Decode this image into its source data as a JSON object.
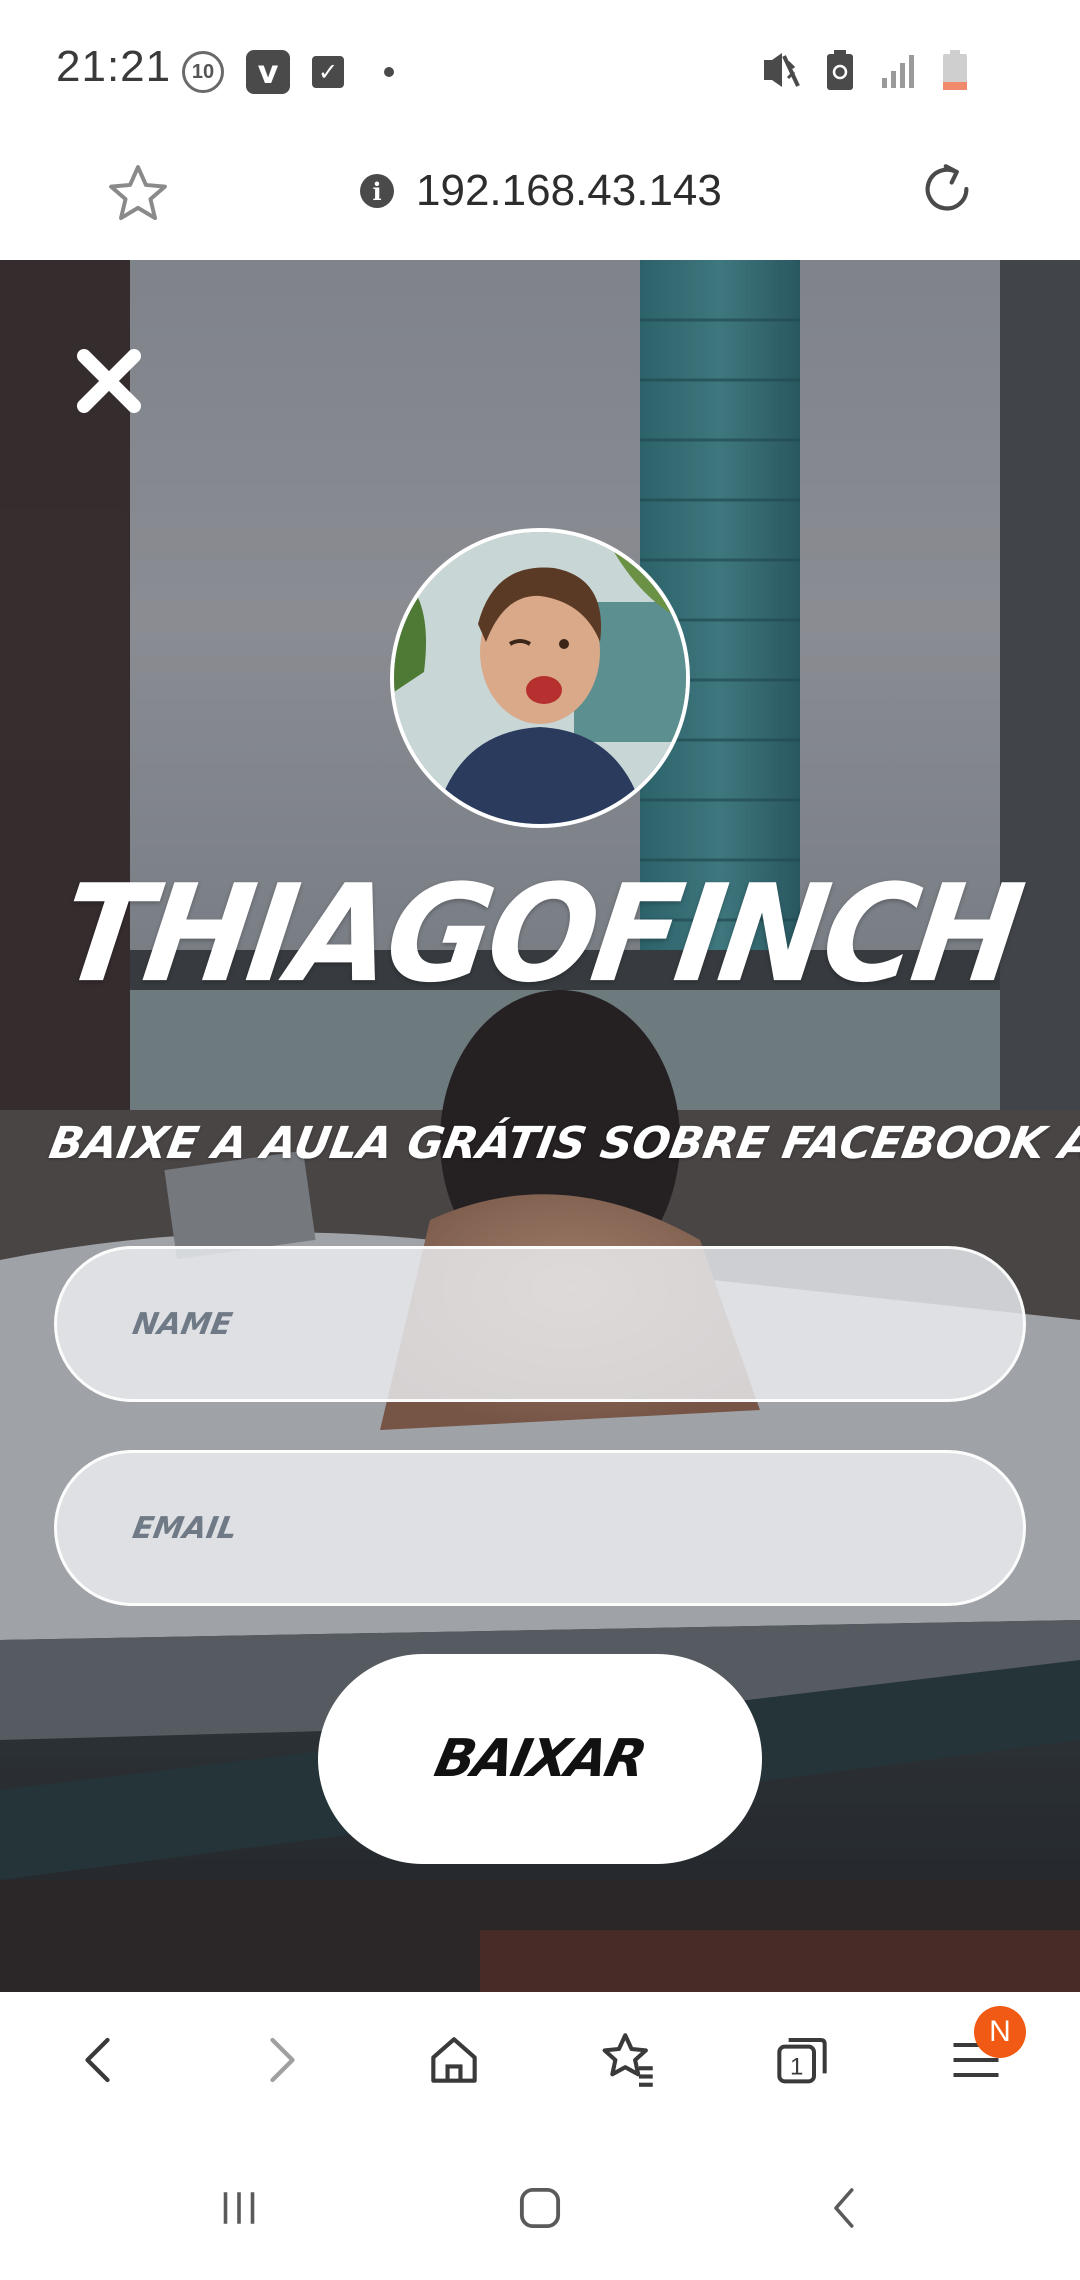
{
  "status_bar": {
    "time": "21:21",
    "notification_badge": "10",
    "icons_left": [
      "countdown-10-icon",
      "vivaldi-icon",
      "check-icon",
      "dot-icon"
    ],
    "icons_right": [
      "mute-vibrate-icon",
      "battery-saver-icon",
      "signal-icon",
      "battery-low-icon"
    ]
  },
  "address_bar": {
    "url": "192.168.43.143",
    "info_glyph": "i",
    "icons": [
      "star-icon",
      "info-icon",
      "reload-icon"
    ]
  },
  "page": {
    "brand_title": "THIAGOFINCH",
    "subtitle": "BAIXE A AULA GRÁTIS SOBRE FACEBOOK ADS.",
    "name_placeholder": "NAME",
    "email_placeholder": "EMAIL",
    "submit_label": "BAIXAR",
    "close_icon": "close-icon"
  },
  "browser_toolbar": {
    "items": [
      "back-icon",
      "forward-icon",
      "home-icon",
      "bookmarks-icon",
      "tabs-icon",
      "menu-icon"
    ],
    "tabs_count": "1",
    "menu_badge": "N",
    "badge_color": "#f05a14"
  },
  "nav_bar": {
    "items": [
      "recents-icon",
      "home-icon",
      "back-icon"
    ]
  },
  "colors": {
    "accent": "#f05a14",
    "overlay": "#28282f",
    "field_bg": "#eceef2",
    "placeholder": "#6f7a86"
  }
}
